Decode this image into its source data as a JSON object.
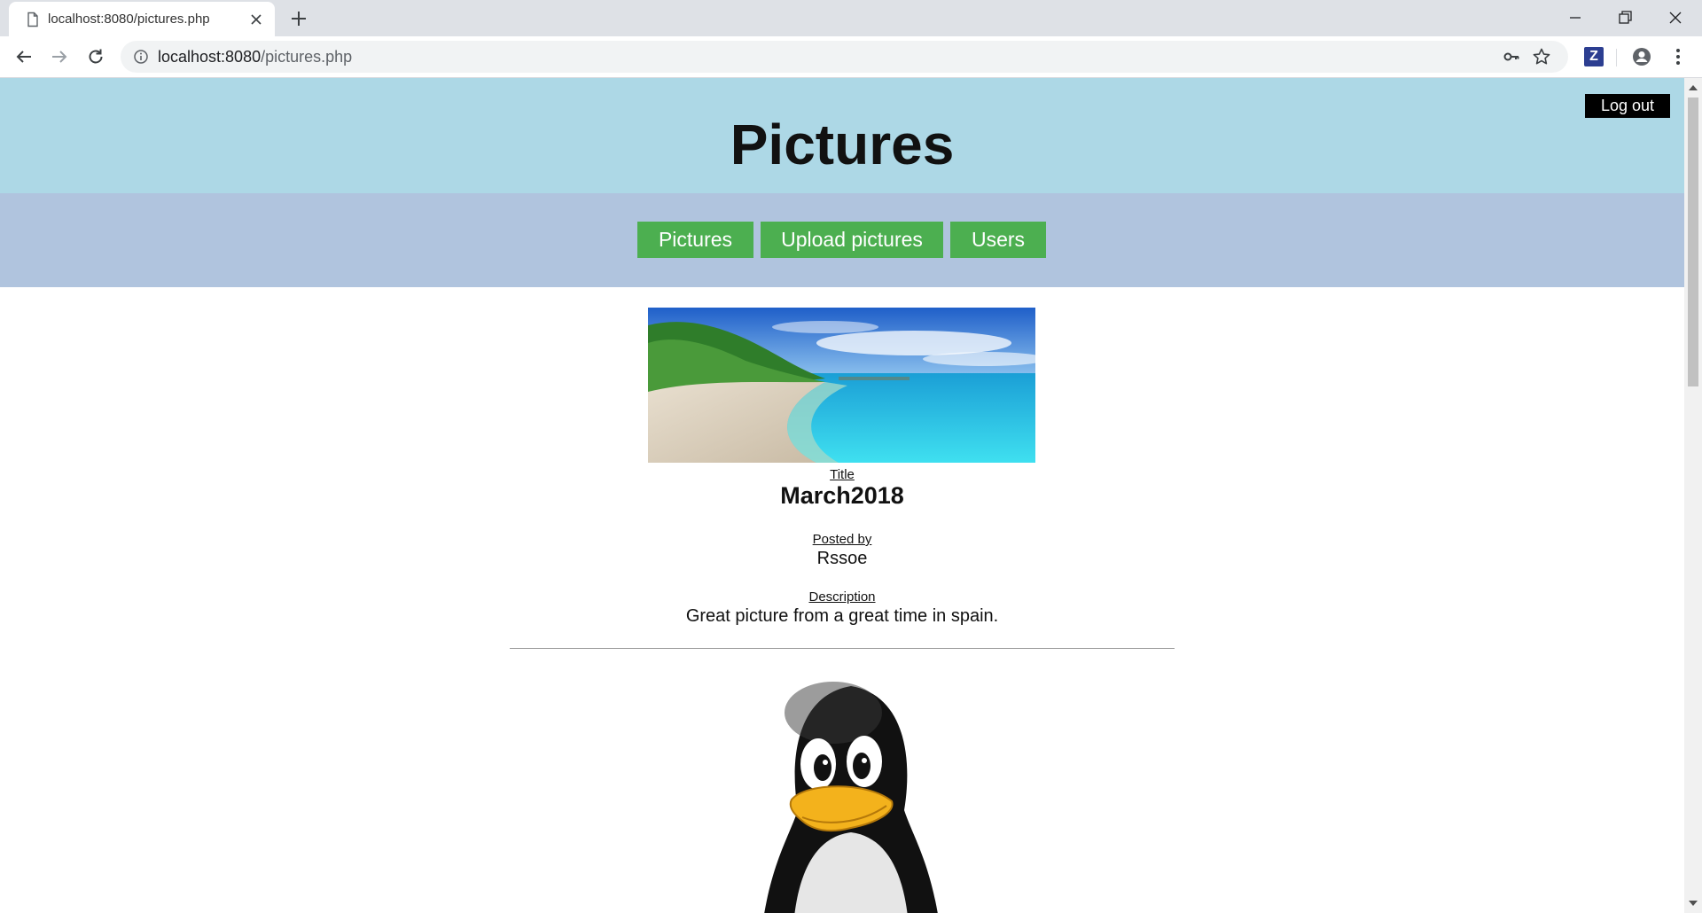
{
  "browser": {
    "tab_title": "localhost:8080/pictures.php",
    "url_host": "localhost:8080",
    "url_path": "/pictures.php",
    "extension_label": "Z"
  },
  "page": {
    "title": "Pictures",
    "logout_label": "Log out",
    "nav": [
      {
        "label": "Pictures"
      },
      {
        "label": "Upload pictures"
      },
      {
        "label": "Users"
      }
    ]
  },
  "posts": [
    {
      "title_label": "Title",
      "title": "March2018",
      "posted_by_label": "Posted by",
      "posted_by": "Rssoe",
      "description_label": "Description",
      "description": "Great picture from a great time in spain.",
      "image": "beach-photo"
    },
    {
      "image": "penguin-photo"
    }
  ],
  "colors": {
    "header_bg": "#add8e6",
    "nav_bg": "#b0c4de",
    "nav_button": "#4caf50",
    "logout_button": "#000000"
  }
}
